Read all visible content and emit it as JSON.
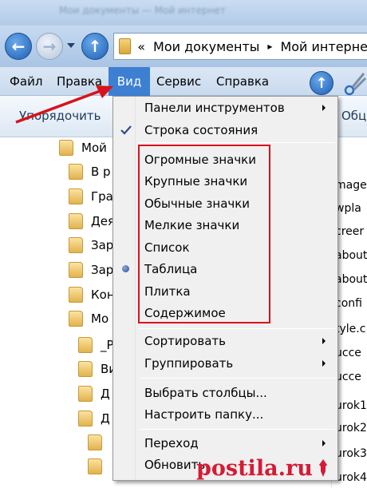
{
  "window": {
    "title": "Мои документы — Мой интернет"
  },
  "address": {
    "separator": "«",
    "parts": [
      "Мои документы",
      "Мой интерне"
    ],
    "arrow": "▸"
  },
  "nav": {
    "back": "back-arrow-icon",
    "forward": "forward-arrow-icon",
    "up": "up-arrow-icon"
  },
  "menubar": {
    "file": "Файл",
    "edit": "Правка",
    "view": "Вид",
    "tools": "Сервис",
    "help": "Справка"
  },
  "toolbar": {
    "organize": "Упорядочить",
    "right_label": "Обц"
  },
  "tree": {
    "items": [
      {
        "label": "Мой"
      },
      {
        "label": "В р"
      },
      {
        "label": "Гра"
      },
      {
        "label": "Дея"
      },
      {
        "label": "Зар"
      },
      {
        "label": "Зар"
      },
      {
        "label": "Кон"
      },
      {
        "label": "Мо"
      },
      {
        "label": "_P"
      },
      {
        "label": "Ви"
      },
      {
        "label": "Д"
      },
      {
        "label": "Д"
      }
    ]
  },
  "files": [
    "mage",
    "wpla",
    "creer",
    "about",
    "about",
    "confi",
    "tyle.c",
    "ucce",
    "ucce",
    "urok1",
    "urok2",
    "urok3",
    "urok4"
  ],
  "menu": {
    "toolbars": "Панели инструментов",
    "status_bar": "Строка состояния",
    "extra_large_icons": "Огромные значки",
    "large_icons": "Крупные значки",
    "medium_icons": "Обычные значки",
    "small_icons": "Мелкие значки",
    "list": "Список",
    "details": "Таблица",
    "tiles": "Плитка",
    "content": "Содержимое",
    "sort_by": "Сортировать",
    "group_by": "Группировать",
    "choose_details": "Выбрать столбцы...",
    "customize_folder": "Настроить папку...",
    "go_to": "Переход",
    "refresh": "Обновить"
  },
  "watermark": {
    "text": "postila.ru"
  },
  "colors": {
    "highlight": "#3d7fd1",
    "annotation_red": "#d8121c",
    "watermark_red": "#d51b35"
  }
}
